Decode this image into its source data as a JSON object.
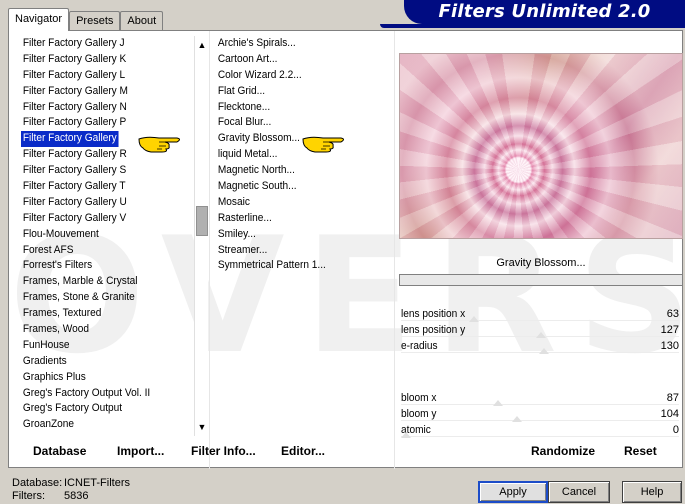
{
  "tabs": [
    "Navigator",
    "Presets",
    "About"
  ],
  "brand_title": "Filters Unlimited 2.0",
  "watermark_text": "OVERS",
  "categories": [
    "Filter Factory Gallery J",
    "Filter Factory Gallery K",
    "Filter Factory Gallery L",
    "Filter Factory Gallery M",
    "Filter Factory Gallery N",
    "Filter Factory Gallery P",
    "Filter Factory Gallery Q",
    "Filter Factory Gallery R",
    "Filter Factory Gallery S",
    "Filter Factory Gallery T",
    "Filter Factory Gallery U",
    "Filter Factory Gallery V",
    "Flou-Mouvement",
    "Forest AFS",
    "Forrest's Filters",
    "Frames, Marble & Crystal",
    "Frames, Stone & Granite",
    "Frames, Textured",
    "Frames, Wood",
    "FunHouse",
    "Gradients",
    "Graphics Plus",
    "Greg's Factory Output Vol. II",
    "Greg's Factory Output",
    "GroanZone"
  ],
  "selected_category_index": 6,
  "filters": [
    "Archie's Spirals...",
    "Cartoon Art...",
    "Color Wizard 2.2...",
    "Flat Grid...",
    "Flecktone...",
    "Focal Blur...",
    "Gravity Blossom...",
    "liquid Metal...",
    "Magnetic North...",
    "Magnetic South...",
    "Mosaic",
    "Rasterline...",
    "Smiley...",
    "Streamer...",
    "Symmetrical Pattern 1..."
  ],
  "selected_filter_name": "Gravity Blossom...",
  "progress": 0,
  "params": [
    {
      "label": "lens position x",
      "value": "63",
      "fraction": 0.25
    },
    {
      "label": "lens position y",
      "value": "127",
      "fraction": 0.5
    },
    {
      "label": "e-radius",
      "value": "130",
      "fraction": 0.51
    }
  ],
  "params2": [
    {
      "label": "bloom x",
      "value": "87",
      "fraction": 0.34
    },
    {
      "label": "bloom y",
      "value": "104",
      "fraction": 0.41
    },
    {
      "label": "atomic",
      "value": "0",
      "fraction": 0.0
    }
  ],
  "panel_buttons": {
    "database": "Database",
    "import": "Import...",
    "filter_info": "Filter Info...",
    "editor": "Editor...",
    "randomize": "Randomize",
    "reset": "Reset"
  },
  "status": {
    "database_label": "Database:",
    "database_value": "ICNET-Filters",
    "filters_label": "Filters:",
    "filters_value": "5836"
  },
  "footer_buttons": {
    "apply": "Apply",
    "cancel": "Cancel",
    "help": "Help"
  },
  "colors": {
    "selection": "#0a2bc8",
    "brand": "#000c82",
    "hand": "#ffd400"
  }
}
